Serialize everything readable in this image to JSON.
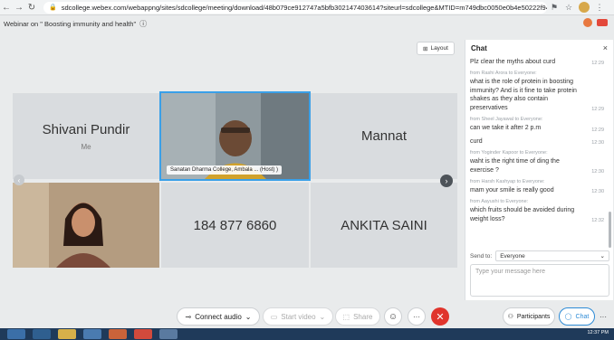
{
  "browser": {
    "url": "sdcollege.webex.com/webappng/sites/sdcollege/meeting/download/48b079ce912747a5bfb302147403614?siteurl=sdcollege&MTID=m749dbc0050e0b4e50222f94887653..."
  },
  "meeting": {
    "title": "Webinar on \" Boosting immunity and health\"",
    "layout_label": "Layout"
  },
  "tiles": {
    "shivani": {
      "name": "Shivani Pundir",
      "sub": "Me"
    },
    "host": {
      "label": "Sanatan Dharma College, Ambala ... (Host) )"
    },
    "mannat": {
      "name": "Mannat"
    },
    "phone": {
      "name": "184 877 6860"
    },
    "ankita": {
      "name": "ANKITA SAINI"
    }
  },
  "controls": {
    "connect_audio": "Connect audio",
    "start_video": "Start video",
    "share": "Share",
    "participants": "Participants",
    "chat": "Chat"
  },
  "chat": {
    "title": "Chat",
    "messages": [
      {
        "from": "",
        "text": "Plz clear the myths about curd",
        "time": "12:29"
      },
      {
        "from": "from Rashi Arora to Everyone:",
        "text": "what is the role of protein in boosting immunity? And is it fine to take protein shakes as they also contain preservatives",
        "time": "12:29"
      },
      {
        "from": "from Sheel Jayawal to Everyone:",
        "text": "can we take it after 2 p.m",
        "time": "12:29"
      },
      {
        "from": "",
        "text": "curd",
        "time": "12:30"
      },
      {
        "from": "from Yoginder Kapoor to Everyone:",
        "text": "waht is the right time of ding the exercise ?",
        "time": "12:30"
      },
      {
        "from": "from Harsh Kashyap to Everyone:",
        "text": "mam your smile is really good",
        "time": "12:30"
      },
      {
        "from": "from Aayushi to Everyone:",
        "text": "which fruits should be avoided during weight loss?",
        "time": "12:32"
      }
    ],
    "send_to_label": "Send to:",
    "send_to_value": "Everyone",
    "input_placeholder": "Type your message here"
  },
  "taskbar": {
    "clock": "12:37 PM"
  },
  "colors": {
    "accent": "#2d8bd6",
    "leave": "#e0342c",
    "active_tile_border": "#3aa0e8"
  }
}
